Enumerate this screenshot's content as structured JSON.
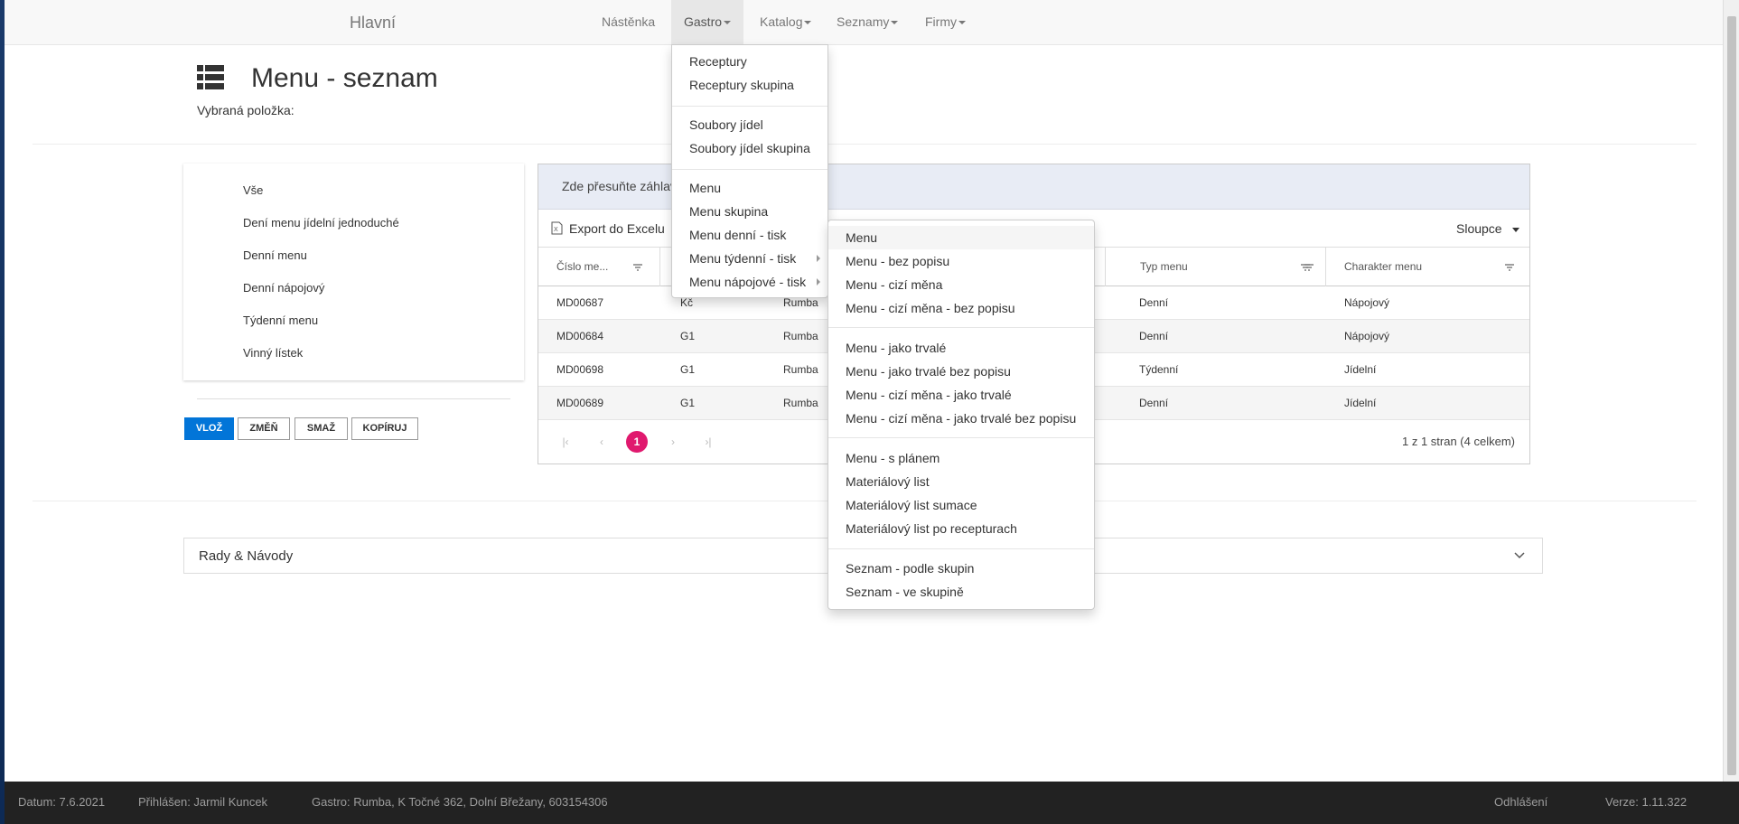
{
  "navbar": {
    "brand": "Hlavní",
    "items": [
      {
        "label": "Nástěnka",
        "has_caret": false
      },
      {
        "label": "Gastro",
        "has_caret": true,
        "active": true
      },
      {
        "label": "Katalog",
        "has_caret": true
      },
      {
        "label": "Seznamy",
        "has_caret": true
      },
      {
        "label": "Firmy",
        "has_caret": true
      }
    ]
  },
  "header": {
    "icon": "list-icon",
    "title": "Menu - seznam",
    "selected_label": "Vybraná položka:"
  },
  "left_panel": {
    "items": [
      "Vše",
      "Dení menu jídelní jednoduché",
      "Denní menu",
      "Denní nápojový",
      "Týdenní menu",
      "Vinný lístek"
    ]
  },
  "buttons": {
    "insert": "VLOŽ",
    "change": "ZMĚŇ",
    "delete": "SMAŽ",
    "copy": "KOPÍRUJ"
  },
  "grid": {
    "group_hint": "Zde přesuňte záhlav",
    "export_label": "Export do Excelu",
    "columns_label": "Sloupce",
    "headers": [
      "Číslo me...",
      "",
      "",
      "Typ menu",
      "Charakter menu"
    ],
    "rows": [
      {
        "cislo": "MD00687",
        "c2": "Kč",
        "c3": "Rumba",
        "typ": "Denní",
        "charakter": "Nápojový"
      },
      {
        "cislo": "MD00684",
        "c2": "G1",
        "c3": "Rumba",
        "typ": "Denní",
        "charakter": "Nápojový"
      },
      {
        "cislo": "MD00698",
        "c2": "G1",
        "c3": "Rumba",
        "typ": "Týdenní",
        "charakter": "Jídelní"
      },
      {
        "cislo": "MD00689",
        "c2": "G1",
        "c3": "Rumba",
        "typ": "Denní",
        "charakter": "Jídelní"
      }
    ],
    "pager": {
      "current_page": "1",
      "info": "1 z 1 stran (4 celkem)"
    }
  },
  "rady": {
    "label": "Rady & Návody"
  },
  "gastro_menu": {
    "groups": [
      [
        "Receptury",
        "Receptury skupina"
      ],
      [
        "Soubory jídel",
        "Soubory jídel skupina"
      ],
      [
        "Menu",
        "Menu skupina",
        "Menu denní - tisk",
        "Menu týdenní - tisk",
        "Menu nápojové - tisk"
      ]
    ]
  },
  "submenu": {
    "groups": [
      [
        "Menu",
        "Menu - bez popisu",
        "Menu - cizí měna",
        "Menu - cizí měna - bez popisu"
      ],
      [
        "Menu - jako trvalé",
        "Menu - jako trvalé bez popisu",
        "Menu - cizí měna - jako trvalé",
        "Menu - cizí měna - jako trvalé bez popisu"
      ],
      [
        "Menu - s plánem",
        "Materiálový list",
        "Materiálový list sumace",
        "Materiálový list po recepturach"
      ],
      [
        "Seznam - podle skupin",
        "Seznam - ve skupině"
      ]
    ]
  },
  "footer": {
    "date": "Datum: 7.6.2021",
    "user": "Přihlášen: Jarmil Kuncek",
    "gastro": "Gastro: Rumba, K Točné 362, Dolní Břežany, 603154306",
    "logout": "Odhlášení",
    "version": "Verze: 1.11.322"
  },
  "colors": {
    "primary": "#0275d8",
    "pager_active": "#e0196e",
    "footer_bg": "#222222",
    "group_bar": "#e8ecf5"
  }
}
